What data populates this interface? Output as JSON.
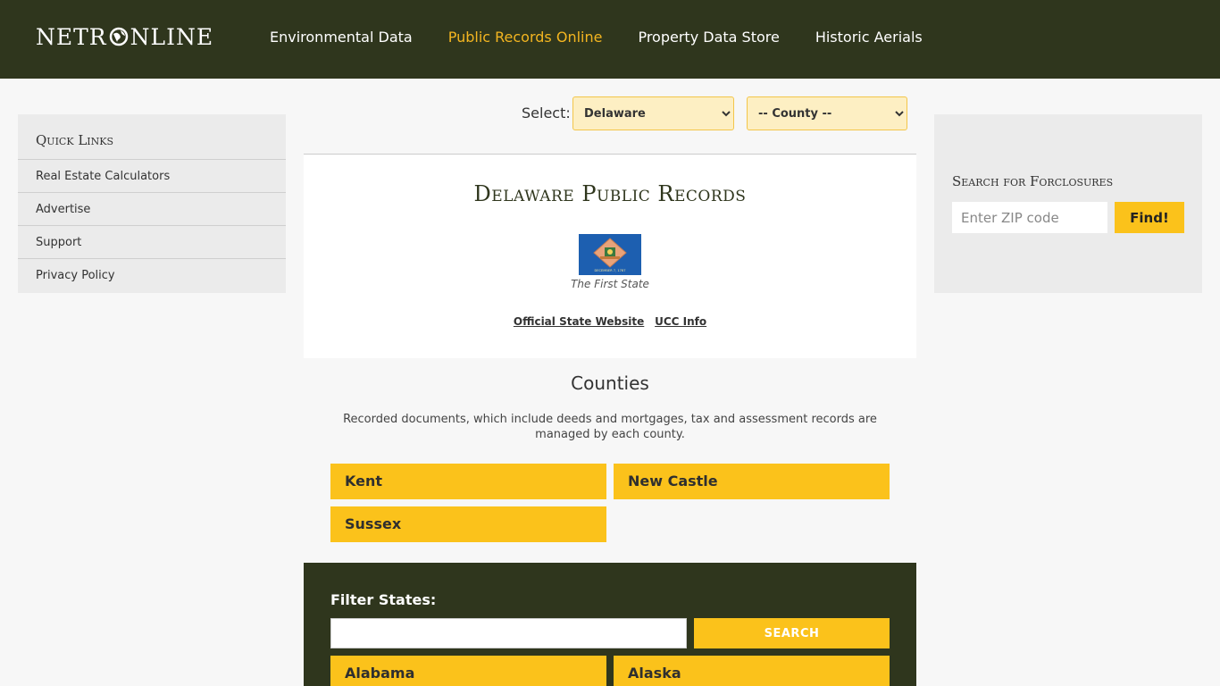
{
  "header": {
    "logo_left": "NETR",
    "logo_right": "NLINE",
    "nav": [
      {
        "label": "Environmental Data",
        "active": false
      },
      {
        "label": "Public Records Online",
        "active": true
      },
      {
        "label": "Property Data Store",
        "active": false
      },
      {
        "label": "Historic Aerials",
        "active": false
      }
    ]
  },
  "quick_links": {
    "title": "Quick Links",
    "items": [
      "Real Estate Calculators",
      "Advertise",
      "Support",
      "Privacy Policy"
    ]
  },
  "foreclosure": {
    "title": "Search for Forclosures",
    "zip_placeholder": "Enter ZIP code",
    "find_label": "Find!"
  },
  "selector": {
    "label": "Select:",
    "state_value": "Delaware",
    "county_value": "-- County --"
  },
  "card": {
    "title": "Delaware Public Records",
    "flag_date": "DECEMBER 7, 1787",
    "motto": "The First State",
    "links": [
      "Official State Website",
      "UCC Info"
    ]
  },
  "counties": {
    "title": "Counties",
    "description": "Recorded documents, which include deeds and mortgages, tax and assessment records are managed by each county.",
    "items": [
      "Kent",
      "New Castle",
      "Sussex"
    ]
  },
  "filter": {
    "label": "Filter States:",
    "search_label": "SEARCH",
    "states": [
      "Alabama",
      "Alaska"
    ]
  },
  "colors": {
    "header_bg": "#2f361d",
    "accent": "#fbc21b",
    "active_nav": "#f3b520"
  }
}
